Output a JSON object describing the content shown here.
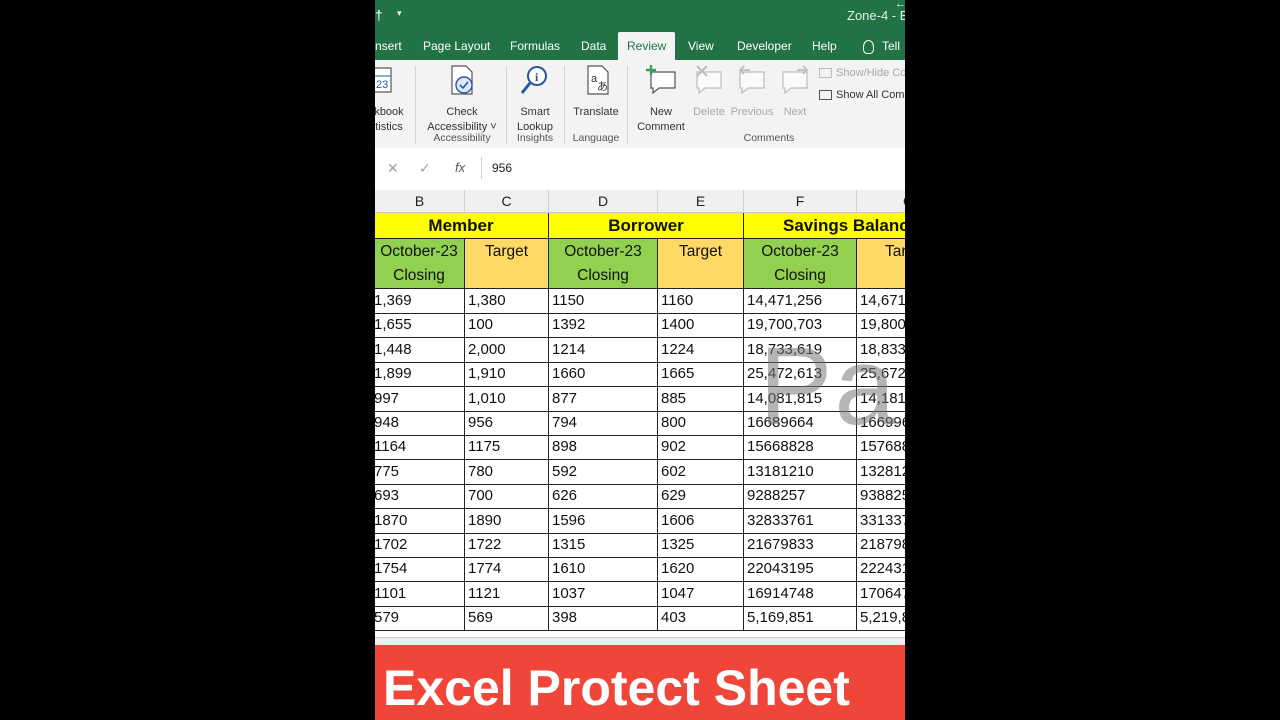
{
  "title_bar": {
    "doc_title": "Zone-4  -  E"
  },
  "tabs": [
    {
      "label": "nsert"
    },
    {
      "label": "Page Layout"
    },
    {
      "label": "Formulas"
    },
    {
      "label": "Data"
    },
    {
      "label": "Review",
      "active": true
    },
    {
      "label": "View"
    },
    {
      "label": "Developer"
    },
    {
      "label": "Help"
    },
    {
      "label": "Tell"
    }
  ],
  "ribbon": {
    "workbook_stats": {
      "line1": "kbook",
      "line2": "tistics"
    },
    "check_accessibility": {
      "line1": "Check",
      "line2": "Accessibility ˅"
    },
    "smart_lookup": {
      "line1": "Smart",
      "line2": "Lookup"
    },
    "translate": {
      "label": "Translate"
    },
    "new_comment": {
      "line1": "New",
      "line2": "Comment"
    },
    "delete": {
      "label": "Delete"
    },
    "previous": {
      "label": "Previous"
    },
    "next": {
      "label": "Next"
    },
    "show_hide": {
      "label": "Show/Hide Co"
    },
    "show_all": {
      "label": "Show All Com"
    },
    "groups": {
      "accessibility": "Accessibility",
      "insights": "Insights",
      "language": "Language",
      "comments": "Comments"
    }
  },
  "formula_bar": {
    "value": "956"
  },
  "columns": [
    "B",
    "C",
    "D",
    "E",
    "F",
    "G"
  ],
  "headers": {
    "member": "Member",
    "borrower": "Borrower",
    "savings": "Savings Balanc",
    "closing_line1": "October-23",
    "closing_line2": "Closing",
    "target": "Target",
    "target_partial": "Tar"
  },
  "rows": [
    [
      "1,369",
      "1,380",
      "1150",
      "1160",
      "14,471,256",
      "14,671"
    ],
    [
      "1,655",
      "100",
      "1392",
      "1400",
      "19,700,703",
      "19,800"
    ],
    [
      "1,448",
      "2,000",
      "1214",
      "1224",
      "18,733,619",
      "18,833"
    ],
    [
      "1,899",
      "1,910",
      "1660",
      "1665",
      "25,472,613",
      "25,672"
    ],
    [
      "997",
      "1,010",
      "877",
      "885",
      "14,081,815",
      "14,181"
    ],
    [
      "948",
      "956",
      "794",
      "800",
      "16689664",
      "166996"
    ],
    [
      "1164",
      "1175",
      "898",
      "902",
      "15668828",
      "157688"
    ],
    [
      "775",
      "780",
      "592",
      "602",
      "13181210",
      "132812"
    ],
    [
      "693",
      "700",
      "626",
      "629",
      "9288257",
      "938825"
    ],
    [
      "1870",
      "1890",
      "1596",
      "1606",
      "32833761",
      "331337"
    ],
    [
      "1702",
      "1722",
      "1315",
      "1325",
      "21679833",
      "218798"
    ],
    [
      "1754",
      "1774",
      "1610",
      "1620",
      "22043195",
      "222431"
    ],
    [
      "1101",
      "1121",
      "1037",
      "1047",
      "16914748",
      "170647"
    ],
    [
      "579",
      "569",
      "398",
      "403",
      "5,169,851",
      "5,219,8"
    ]
  ],
  "watermark": "Pa",
  "banner": "Excel Protect Sheet"
}
